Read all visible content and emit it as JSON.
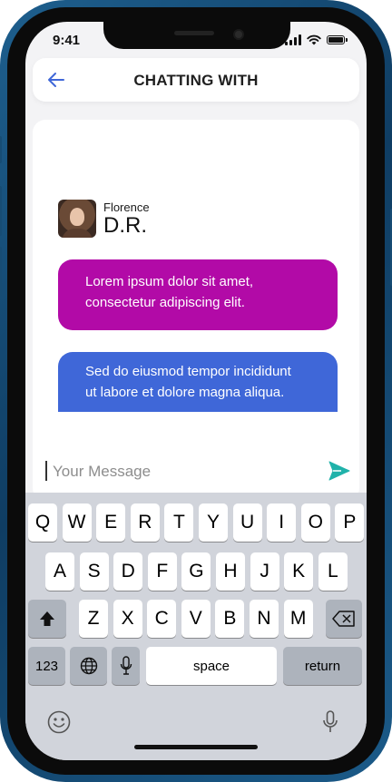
{
  "status_bar": {
    "time": "9:41"
  },
  "header": {
    "title": "CHATTING WITH",
    "back_icon": "arrow-left-icon"
  },
  "contact": {
    "first_name": "Florence",
    "last_name": "D.R."
  },
  "messages": [
    {
      "line1": "Lorem ipsum dolor sit amet,",
      "line2": "consectetur adipiscing elit.",
      "color": "#b20aa7"
    },
    {
      "line1": "Sed do eiusmod tempor incididunt",
      "line2": "ut labore et dolore magna aliqua.",
      "color": "#3f67d8"
    }
  ],
  "composer": {
    "placeholder": "Your Message",
    "value": "",
    "send_icon": "send-icon",
    "accent": "#20b2aa"
  },
  "keyboard": {
    "row1": [
      "Q",
      "W",
      "E",
      "R",
      "T",
      "Y",
      "U",
      "I",
      "O",
      "P"
    ],
    "row2": [
      "A",
      "S",
      "D",
      "F",
      "G",
      "H",
      "J",
      "K",
      "L"
    ],
    "row3": [
      "Z",
      "X",
      "C",
      "V",
      "B",
      "N",
      "M"
    ],
    "numbers_key": "123",
    "space_key": "space",
    "return_key": "return",
    "icons": [
      "shift-icon",
      "backspace-icon",
      "globe-icon",
      "microphone-icon",
      "emoji-icon",
      "dictation-icon"
    ]
  },
  "colors": {
    "phone_frame": "#1e5f8e",
    "screen_bg": "#f3f3f5",
    "header_bg": "#ffffff"
  }
}
